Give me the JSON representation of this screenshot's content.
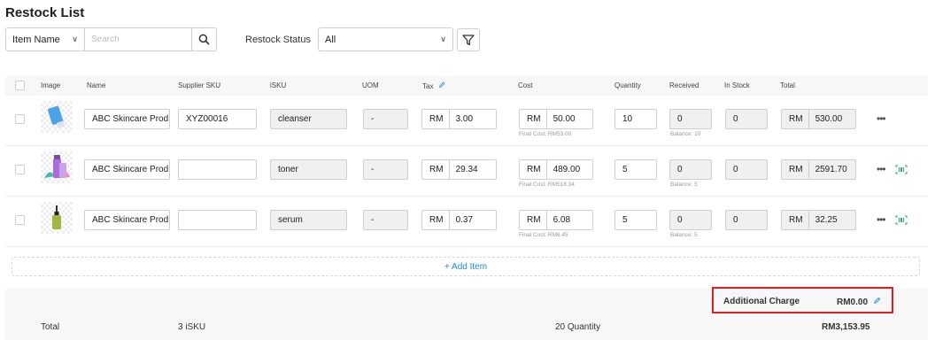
{
  "page": {
    "title": "Restock List"
  },
  "filters": {
    "field_select": "Item Name",
    "search_placeholder": "Search",
    "status_label": "Restock Status",
    "status_value": "All"
  },
  "columns": {
    "image": "Image",
    "name": "Name",
    "supplier_sku": "Supplier SKU",
    "isku": "iSKU",
    "uom": "UOM",
    "tax": "Tax",
    "cost": "Cost",
    "quantity": "Quantity",
    "received": "Received",
    "in_stock": "In Stock",
    "total": "Total"
  },
  "currency": "RM",
  "rows": [
    {
      "name": "ABC Skincare Prod",
      "supplier_sku": "XYZ00016",
      "isku": "cleanser",
      "uom": "-",
      "tax": "3.00",
      "cost": "50.00",
      "final_cost": "Final Cost: RM53.00",
      "quantity": "10",
      "received": "0",
      "balance": "Balance: 10",
      "in_stock": "0",
      "total": "530.00",
      "scan_icon": false,
      "image_icon": "tube-product-icon"
    },
    {
      "name": "ABC Skincare Prod",
      "supplier_sku": "",
      "isku": "toner",
      "uom": "-",
      "tax": "29.34",
      "cost": "489.00",
      "final_cost": "Final Cost: RM518.34",
      "quantity": "5",
      "received": "0",
      "balance": "Balance: 5",
      "in_stock": "0",
      "total": "2591.70",
      "scan_icon": true,
      "image_icon": "toner-product-icon"
    },
    {
      "name": "ABC Skincare Prod",
      "supplier_sku": "",
      "isku": "serum",
      "uom": "-",
      "tax": "0.37",
      "cost": "6.08",
      "final_cost": "Final Cost: RM6.45",
      "quantity": "5",
      "received": "0",
      "balance": "Balance: 5",
      "in_stock": "0",
      "total": "32.25",
      "scan_icon": true,
      "image_icon": "serum-bottle-icon"
    }
  ],
  "add_item": "+ Add Item",
  "footer": {
    "additional_charge_label": "Additional Charge",
    "additional_charge_value": "RM0.00",
    "total_label": "Total",
    "isku_count": "3 iSKU",
    "quantity_total": "20 Quantity",
    "grand_total": "RM3,153.95"
  },
  "colors": {
    "accent": "#1e88e5",
    "highlight": "#e02020",
    "scan_green": "#2fb36b"
  }
}
